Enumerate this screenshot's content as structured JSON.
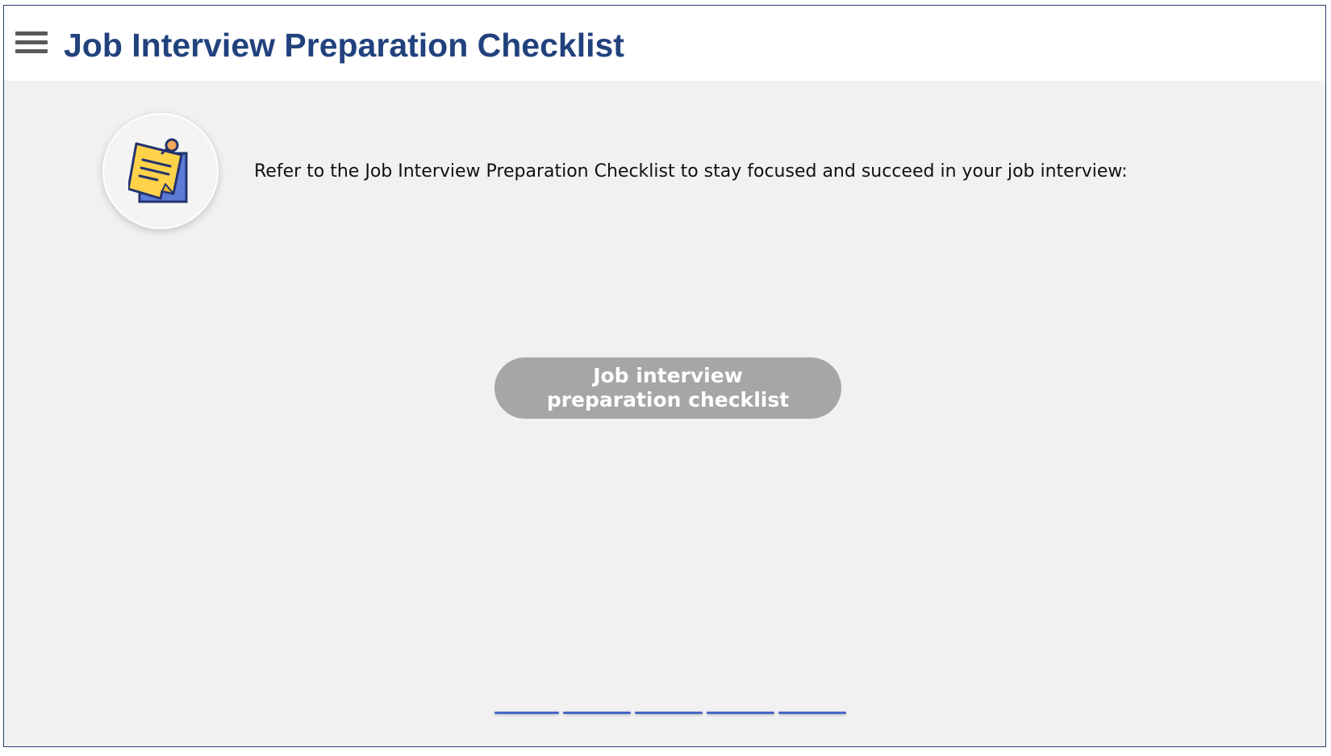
{
  "header": {
    "title": "Job Interview Preparation Checklist",
    "menu_icon": "hamburger-menu-icon"
  },
  "main": {
    "icon": "sticky-note-icon",
    "intro_text": "Refer to the Job Interview Preparation Checklist to stay focused and succeed in your job interview:",
    "button_line1": "Job interview",
    "button_line2": "preparation checklist"
  },
  "pager": {
    "page_count": 5
  },
  "colors": {
    "title": "#22427e",
    "background": "#f1f1f1",
    "button": "#a6a6a6",
    "pager": "#4667c4"
  }
}
